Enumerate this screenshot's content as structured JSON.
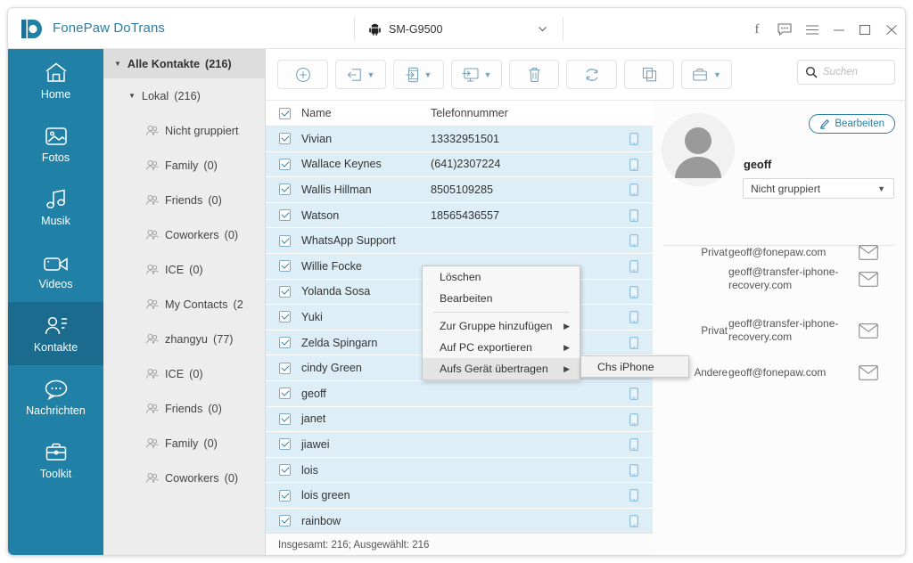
{
  "window": {
    "app_title": "FonePaw DoTrans",
    "logo_icon": "fonepaw-logo-icon",
    "device": {
      "icon": "android-robot-icon",
      "name": "SM-G9500",
      "caret_icon": "chevron-down-icon"
    },
    "controls": [
      {
        "name": "facebook-button",
        "icon": "facebook-f-icon",
        "glyph": "f"
      },
      {
        "name": "feedback-button",
        "icon": "chat-bubble-icon",
        "glyph": ""
      },
      {
        "name": "menu-button",
        "icon": "hamburger-menu-icon",
        "glyph": ""
      },
      {
        "name": "minimize-button",
        "icon": "minimize-icon",
        "glyph": ""
      },
      {
        "name": "maximize-button",
        "icon": "maximize-icon",
        "glyph": ""
      },
      {
        "name": "close-button",
        "icon": "close-x-icon",
        "glyph": ""
      }
    ]
  },
  "sidebar": {
    "items": [
      {
        "label": "Home",
        "icon": "home-icon",
        "active": false
      },
      {
        "label": "Fotos",
        "icon": "photo-icon",
        "active": false
      },
      {
        "label": "Musik",
        "icon": "music-note-icon",
        "active": false
      },
      {
        "label": "Videos",
        "icon": "video-camera-icon",
        "active": false
      },
      {
        "label": "Kontakte",
        "icon": "contact-person-icon",
        "active": true
      },
      {
        "label": "Nachrichten",
        "icon": "message-bubble-icon",
        "active": false
      },
      {
        "label": "Toolkit",
        "icon": "toolbox-icon",
        "active": false
      }
    ]
  },
  "groups": {
    "root": {
      "label": "Alle Kontakte",
      "count": "(216)",
      "expand_icon": "triangle-down-icon"
    },
    "local": {
      "label": "Lokal",
      "count": "(216)",
      "expand_icon": "triangle-down-icon"
    },
    "items": [
      {
        "label": "Nicht gruppiert",
        "count": "",
        "icon": "group-person-icon"
      },
      {
        "label": "Family",
        "count": "(0)",
        "icon": "group-person-icon"
      },
      {
        "label": "Friends",
        "count": "(0)",
        "icon": "group-person-icon"
      },
      {
        "label": "Coworkers",
        "count": "(0)",
        "icon": "group-person-icon"
      },
      {
        "label": "ICE",
        "count": "(0)",
        "icon": "group-person-icon"
      },
      {
        "label": "My Contacts",
        "count": "(2",
        "icon": "group-person-icon"
      },
      {
        "label": "zhangyu",
        "count": "(77)",
        "icon": "group-person-icon"
      },
      {
        "label": "ICE",
        "count": "(0)",
        "icon": "group-person-icon"
      },
      {
        "label": "Friends",
        "count": "(0)",
        "icon": "group-person-icon"
      },
      {
        "label": "Family",
        "count": "(0)",
        "icon": "group-person-icon"
      },
      {
        "label": "Coworkers",
        "count": "(0)",
        "icon": "group-person-icon"
      }
    ]
  },
  "toolbar": {
    "buttons": [
      {
        "name": "add-contact-button",
        "icon": "plus-circle-icon",
        "has_caret": false
      },
      {
        "name": "import-button",
        "icon": "import-arrow-icon",
        "has_caret": true
      },
      {
        "name": "export-to-device-button",
        "icon": "phone-arrow-icon",
        "has_caret": true
      },
      {
        "name": "export-to-pc-button",
        "icon": "monitor-arrow-icon",
        "has_caret": true
      },
      {
        "name": "delete-button",
        "icon": "trash-icon",
        "has_caret": false
      },
      {
        "name": "refresh-button",
        "icon": "refresh-circular-icon",
        "has_caret": false
      },
      {
        "name": "duplicate-button",
        "icon": "copy-pages-icon",
        "has_caret": false
      },
      {
        "name": "toolbox-button",
        "icon": "briefcase-icon",
        "has_caret": true
      }
    ],
    "search": {
      "placeholder": "Suchen",
      "icon": "search-magnifier-icon",
      "value": ""
    }
  },
  "contact_list": {
    "header": {
      "select_all_checked": true,
      "name_column": "Name",
      "phone_column": "Telefonnummer"
    },
    "rows": [
      {
        "checked": true,
        "name": "Vivian",
        "phone": "13332951501",
        "device_icon": "phone-device-icon"
      },
      {
        "checked": true,
        "name": "Wallace Keynes",
        "phone": "(641)2307224",
        "device_icon": "phone-device-icon"
      },
      {
        "checked": true,
        "name": "Wallis Hillman",
        "phone": "8505109285",
        "device_icon": "phone-device-icon"
      },
      {
        "checked": true,
        "name": "Watson",
        "phone": "18565436557",
        "device_icon": "phone-device-icon"
      },
      {
        "checked": true,
        "name": "WhatsApp Support",
        "phone": "",
        "device_icon": "phone-device-icon"
      },
      {
        "checked": true,
        "name": "Willie Focke",
        "phone": "",
        "device_icon": "phone-device-icon"
      },
      {
        "checked": true,
        "name": "Yolanda Sosa",
        "phone": "",
        "device_icon": "phone-device-icon"
      },
      {
        "checked": true,
        "name": "Yuki",
        "phone": "",
        "device_icon": "phone-device-icon"
      },
      {
        "checked": true,
        "name": "Zelda Spingarn",
        "phone": "",
        "device_icon": "phone-device-icon"
      },
      {
        "checked": true,
        "name": "cindy Green",
        "phone": "",
        "device_icon": "phone-device-icon"
      },
      {
        "checked": true,
        "name": "geoff",
        "phone": "",
        "device_icon": "phone-device-icon"
      },
      {
        "checked": true,
        "name": "janet",
        "phone": "",
        "device_icon": "phone-device-icon"
      },
      {
        "checked": true,
        "name": "jiawei",
        "phone": "",
        "device_icon": "phone-device-icon"
      },
      {
        "checked": true,
        "name": "lois",
        "phone": "",
        "device_icon": "phone-device-icon"
      },
      {
        "checked": true,
        "name": "lois green",
        "phone": "",
        "device_icon": "phone-device-icon"
      },
      {
        "checked": true,
        "name": "rainbow",
        "phone": "",
        "device_icon": "phone-device-icon"
      }
    ],
    "footer": "Insgesamt: 216; Ausgewählt: 216"
  },
  "context_menu": {
    "items": [
      {
        "label": "Löschen",
        "has_submenu": false,
        "highlighted": false
      },
      {
        "label": "Bearbeiten",
        "has_submenu": false,
        "highlighted": false
      },
      {
        "separator": true
      },
      {
        "label": "Zur Gruppe hinzufügen",
        "has_submenu": true,
        "highlighted": false
      },
      {
        "label": "Auf PC exportieren",
        "has_submenu": true,
        "highlighted": false
      },
      {
        "label": "Aufs Gerät übertragen",
        "has_submenu": true,
        "highlighted": true
      }
    ],
    "submenu": {
      "items": [
        {
          "label": "Chs iPhone"
        }
      ]
    },
    "arrow_icon": "triangle-right-icon"
  },
  "detail": {
    "avatar_icon": "default-avatar-icon",
    "edit_button": {
      "label": "Bearbeiten",
      "icon": "pencil-edit-icon"
    },
    "name": "geoff",
    "group": {
      "value": "Nicht gruppiert",
      "caret_icon": "triangle-down-icon"
    },
    "fields": [
      {
        "label": "Privat",
        "value": "geoff@fonepaw.com",
        "icon": "envelope-icon"
      },
      {
        "label": "",
        "value": "geoff@transfer-iphone-recovery.com",
        "icon": "envelope-icon"
      },
      {
        "label": "Privat",
        "value": "geoff@transfer-iphone-recovery.com",
        "icon": "envelope-icon"
      },
      {
        "label": "Andere",
        "value": "geoff@fonepaw.com",
        "icon": "envelope-icon"
      }
    ]
  },
  "colors": {
    "brand": "#2180a6",
    "brand_active": "#1a6b8d",
    "row_selected": "#ddeef7",
    "accent_text": "#2a7ea5"
  }
}
